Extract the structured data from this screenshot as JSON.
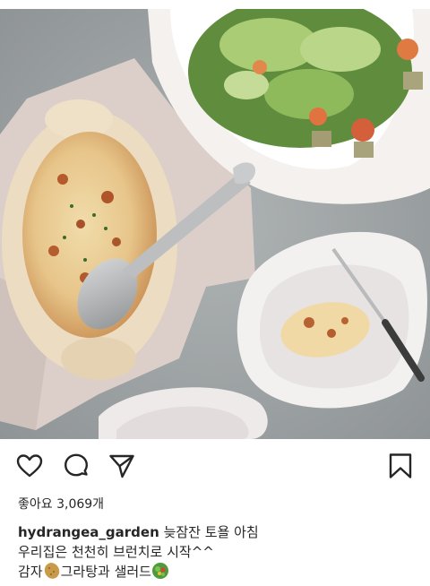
{
  "post": {
    "image_alt": "Potato gratin in a cream oval baking dish with a spoon, a serving on a white scalloped plate with a fork, and a green salad on a large white platter",
    "likes_text": "좋아요 3,069개",
    "username": "hydrangea_garden",
    "caption_line1": "늦잠잔 토욜 아침",
    "caption_line2": "우리집은 천천히 브런치로 시작^^",
    "caption_line3_a": "감자",
    "caption_line3_b": "그라탕과 샐러드"
  },
  "icons": {
    "like": "heart-icon",
    "comment": "comment-icon",
    "share": "paper-plane-icon",
    "bookmark": "bookmark-icon",
    "emoji_1": "potato-emoji",
    "emoji_2": "salad-emoji"
  },
  "colors": {
    "text": "#262626",
    "icon": "#262626",
    "background": "#ffffff"
  }
}
